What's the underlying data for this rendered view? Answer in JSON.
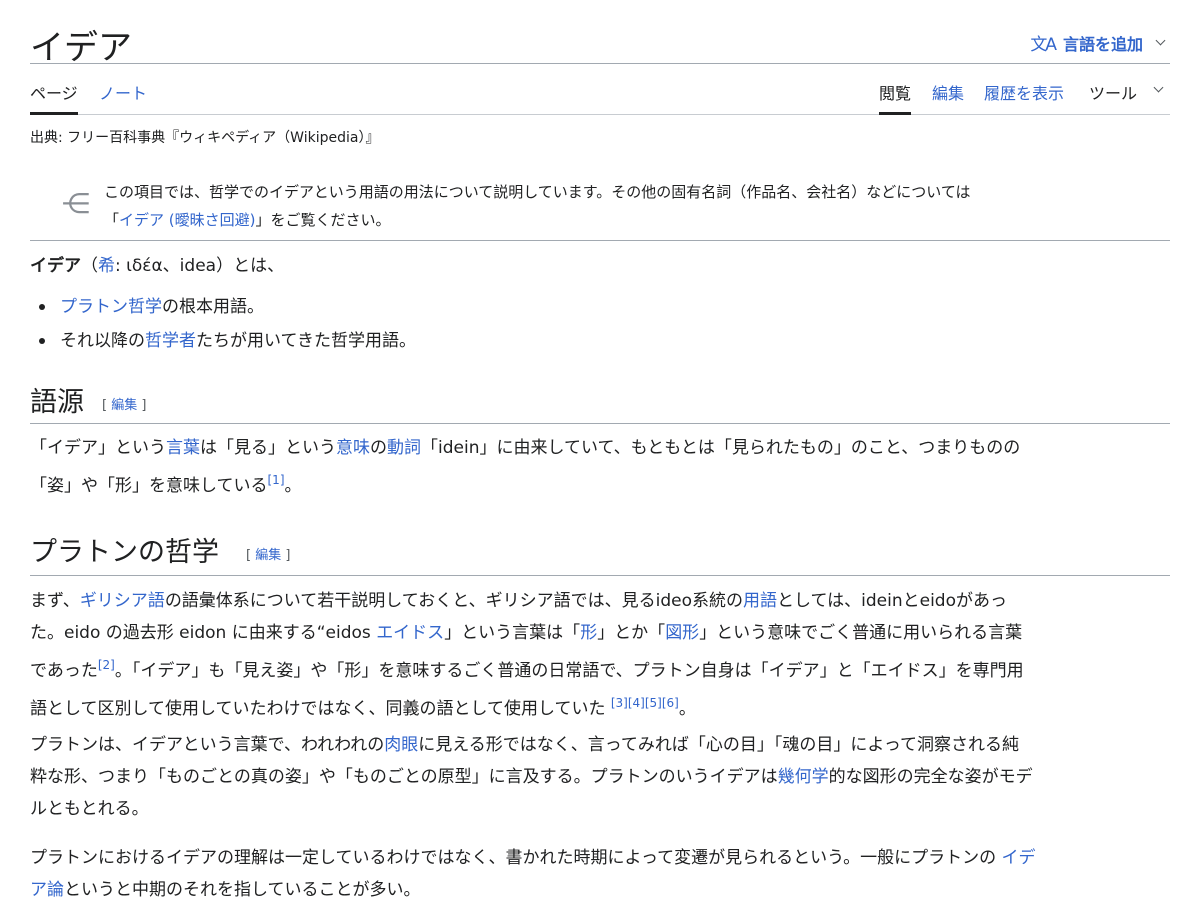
{
  "title": "イデア",
  "lang_button": {
    "icon": "文A",
    "label": "言語を追加"
  },
  "tabs": {
    "page": "ページ",
    "talk": "ノート",
    "read": "閲覧",
    "edit": "編集",
    "history": "履歴を表示",
    "tools": "ツール"
  },
  "from_line": "出典: フリー百科事典『ウィキペディア（Wikipedia）』",
  "hatnote": {
    "line1": "この項目では、哲学でのイデアという用語の用法について説明しています。その他の固有名詞（作品名、会社名）などについては",
    "line2_pre": "「",
    "line2_link": "イデア (曖昧さ回避)",
    "line2_post": "」をご覧ください。"
  },
  "intro": {
    "bold": "イデア",
    "paren_open": "（",
    "greek_link": "希",
    "rest": ": ιδέα、idea）とは、"
  },
  "bullets": [
    {
      "link": "プラトン哲学",
      "text": "の根本用語。"
    },
    {
      "pre": "それ以降の",
      "link": "哲学者",
      "text": "たちが用いてきた哲学用語。"
    }
  ],
  "sections": {
    "etymology": {
      "heading": "語源",
      "edit": "編集"
    },
    "plato": {
      "heading": "プラトンの哲学",
      "edit": "編集"
    }
  },
  "etymology_paragraph": {
    "l1a": "「イデア」という",
    "l1_link1": "言葉",
    "l1b": "は「見る」という",
    "l1_link2": "意味",
    "l1c": "の",
    "l1_link3": "動詞",
    "l1d": "「idein」に由来していて、もともとは「見られたもの」のこと、つまりものの",
    "l2": "「姿」や「形」を意味している",
    "ref": "[1]",
    "end": "。"
  },
  "plato_p1": {
    "l1a": "まず、",
    "l1_link1": "ギリシア語",
    "l1b": "の語彙体系について若干説明しておくと、ギリシア語では、見るideo系統の",
    "l1_link2": "用語",
    "l1c": "としては、ideinとeidoがあっ",
    "l2a": "た。eido の過去形 eidon に由来する“eidos ",
    "l2_link1": "エイドス",
    "l2b": "」という言葉は「",
    "l2_link2": "形",
    "l2c": "」とか「",
    "l2_link3": "図形",
    "l2d": "」という意味でごく普通に用いられる言葉",
    "l3a": "であった",
    "ref2": "[2]",
    "l3b": "。「イデア」も「見え姿」や「形」を意味するごく普通の日常語で、プラトン自身は「イデア」と「エイドス」を専門用",
    "l4a": "語として区別して使用していたわけではなく、同義の語として使用していた ",
    "ref3": "[3][4][5][6]",
    "l4b": "。"
  },
  "plato_p2": {
    "l1a": "プラトンは、イデアという言葉で、われわれの",
    "l1_link": "肉眼",
    "l1b": "に見える形ではなく、言ってみれば「心の目」「魂の目」によって洞察される純",
    "l2": "粋な形、つまり「ものごとの真の姿」や「ものごとの原型」に言及する。プラトンのいうイデアは",
    "l2_link": "幾何学",
    "l2b": "的な図形の完全な姿がモデ",
    "l3": "ルともとれる。"
  },
  "plato_p3": {
    "l1": "プラトンにおけるイデアの理解は一定しているわけではなく、書かれた時期によって変遷が見られるという。一般にプラトンの ",
    "l1_link": "イデ",
    "l2_link": "ア論",
    "l2": "というと中期のそれを指していることが多い。"
  }
}
